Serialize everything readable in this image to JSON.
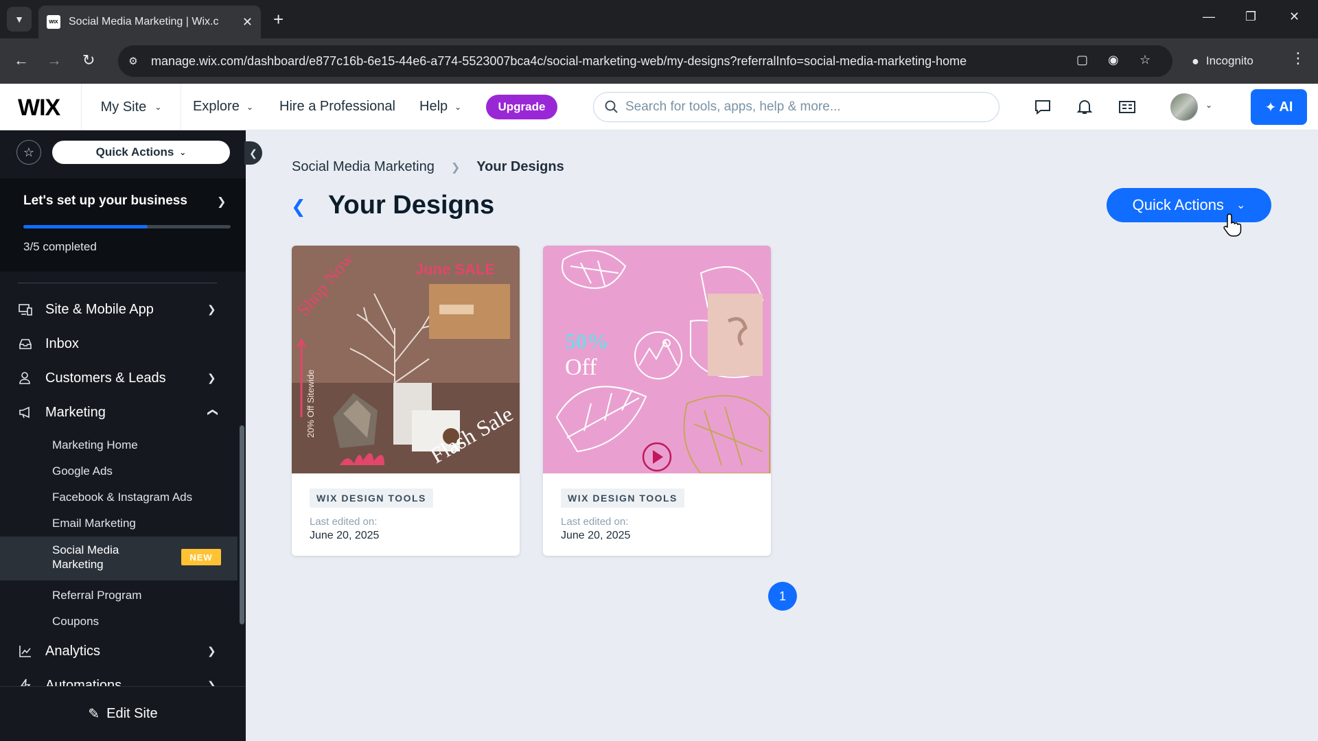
{
  "browser": {
    "tab_title": "Social Media Marketing | Wix.c",
    "favicon_text": "WIX",
    "url": "manage.wix.com/dashboard/e877c16b-6e15-44e6-a774-5523007bca4c/social-marketing-web/my-designs?referralInfo=social-media-marketing-home",
    "incognito_label": "Incognito"
  },
  "topbar": {
    "logo": "WIX",
    "my_site": "My Site",
    "explore": "Explore",
    "hire": "Hire a Professional",
    "help": "Help",
    "upgrade": "Upgrade",
    "search_placeholder": "Search for tools, apps, help & more...",
    "ai_label": "AI"
  },
  "sidebar": {
    "quick_actions": "Quick Actions",
    "setup": {
      "title": "Let's set up your business",
      "status": "3/5 completed",
      "progress": 0.6
    },
    "items": [
      {
        "label": "Site & Mobile App",
        "icon": "monitor-mobile-icon"
      },
      {
        "label": "Inbox",
        "icon": "inbox-icon"
      },
      {
        "label": "Customers & Leads",
        "icon": "customers-icon"
      },
      {
        "label": "Marketing",
        "icon": "megaphone-icon"
      },
      {
        "label": "Analytics",
        "icon": "chart-icon"
      },
      {
        "label": "Automations",
        "icon": "automation-icon"
      }
    ],
    "marketing_sub": [
      "Marketing Home",
      "Google Ads",
      "Facebook & Instagram Ads",
      "Email Marketing",
      "Social Media Marketing",
      "Referral Program",
      "Coupons"
    ],
    "new_badge": "NEW",
    "edit_site": "Edit Site"
  },
  "main": {
    "breadcrumb": [
      "Social Media Marketing",
      "Your Designs"
    ],
    "title": "Your Designs",
    "quick_actions": "Quick Actions",
    "cards": [
      {
        "tag": "WIX DESIGN TOOLS",
        "meta": "Last edited on:",
        "date": "June 20, 2025",
        "image_text": {
          "top": "June SALE",
          "side": "Shop Now",
          "vertical": "20% Off Sitewide",
          "bottom": "Flash Sale"
        }
      },
      {
        "tag": "WIX DESIGN TOOLS",
        "meta": "Last edited on:",
        "date": "June 20, 2025",
        "image_text": {
          "percent": "50%",
          "off": "Off"
        }
      }
    ],
    "page": "1"
  },
  "colors": {
    "accent": "#116dff",
    "upgrade": "#9a27d5",
    "sidebar": "#15191f",
    "background": "#e9edf3",
    "card1_bg": "#8d6a5c",
    "card2_bg": "#e9a0d0"
  }
}
